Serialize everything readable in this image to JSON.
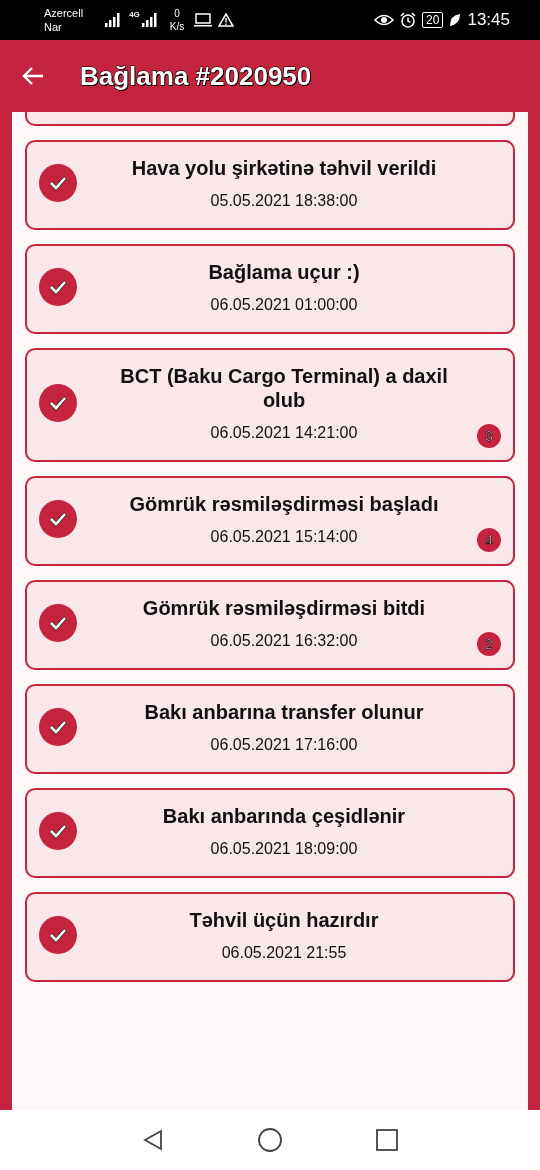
{
  "status_bar": {
    "carriers": [
      "Azercell",
      "Nar"
    ],
    "network": "4G",
    "speed_value": "0",
    "speed_unit": "K/s",
    "battery": "20",
    "time": "13:45"
  },
  "header": {
    "title": "Bağlama #2020950"
  },
  "events": [
    {
      "title": "Hava yolu şirkətinə təhvil verildi",
      "time": "05.05.2021 18:38:00",
      "done": true
    },
    {
      "title": "Bağlama uçur :)",
      "time": "06.05.2021 01:00:00",
      "done": true
    },
    {
      "title": "BCT (Baku Cargo Terminal) a daxil olub",
      "time": "06.05.2021 14:21:00",
      "done": true,
      "badge": "3"
    },
    {
      "title": "Gömrük rəsmiləşdirməsi başladı",
      "time": "06.05.2021 15:14:00",
      "done": true,
      "badge": "4"
    },
    {
      "title": "Gömrük rəsmiləşdirməsi bitdi",
      "time": "06.05.2021 16:32:00",
      "done": true,
      "badge": "2"
    },
    {
      "title": "Bakı anbarına transfer olunur",
      "time": "06.05.2021 17:16:00",
      "done": true
    },
    {
      "title": "Bakı anbarında çeşidlənir",
      "time": "06.05.2021 18:09:00",
      "done": true
    },
    {
      "title": "Təhvil üçün hazırdır",
      "time": "06.05.2021 21:55",
      "done": true
    }
  ]
}
